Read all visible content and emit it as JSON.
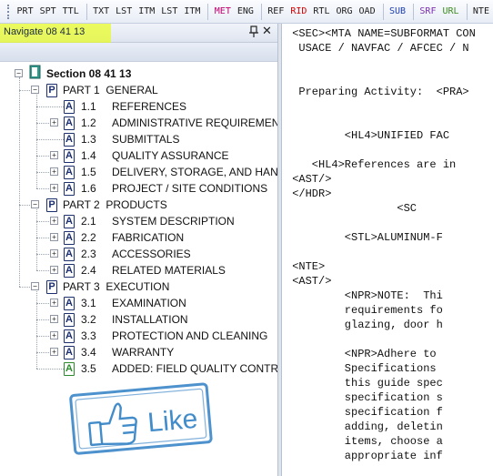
{
  "toolbar": {
    "groups": [
      [
        {
          "label": "PRT",
          "color": "#1d1d1d"
        },
        {
          "label": "SPT",
          "color": "#1d1d1d"
        },
        {
          "label": "TTL",
          "color": "#1d1d1d"
        }
      ],
      [
        {
          "label": "TXT",
          "color": "#1d1d1d"
        },
        {
          "label": "LST",
          "color": "#1d1d1d"
        },
        {
          "label": "ITM",
          "color": "#1d1d1d"
        },
        {
          "label": "LST",
          "color": "#1d1d1d"
        },
        {
          "label": "ITM",
          "color": "#1d1d1d"
        }
      ],
      [
        {
          "label": "MET",
          "color": "#c0006e"
        },
        {
          "label": "ENG",
          "color": "#1d1d1d"
        }
      ],
      [
        {
          "label": "REF",
          "color": "#1d1d1d"
        },
        {
          "label": "RID",
          "color": "#d40000"
        },
        {
          "label": "RTL",
          "color": "#1d1d1d"
        },
        {
          "label": "ORG",
          "color": "#1d1d1d"
        },
        {
          "label": "OAD",
          "color": "#1d1d1d"
        }
      ],
      [
        {
          "label": "SUB",
          "color": "#1d3fb0"
        }
      ],
      [
        {
          "label": "SRF",
          "color": "#7a2fb0"
        },
        {
          "label": "URL",
          "color": "#3c8c1e"
        }
      ],
      [
        {
          "label": "NTE",
          "color": "#1d1d1d"
        }
      ]
    ]
  },
  "nav": {
    "title": "Navigate 08 41 13",
    "highlight_color": "#e9ff00"
  },
  "tree": {
    "section": "Section 08 41 13",
    "parts": [
      {
        "label": "PART 1  GENERAL",
        "items": [
          {
            "num": "1.1",
            "title": "REFERENCES",
            "expandable": false
          },
          {
            "num": "1.2",
            "title": "ADMINISTRATIVE REQUIREMENTS",
            "expandable": true
          },
          {
            "num": "1.3",
            "title": "SUBMITTALS",
            "expandable": false
          },
          {
            "num": "1.4",
            "title": "QUALITY ASSURANCE",
            "expandable": true
          },
          {
            "num": "1.5",
            "title": "DELIVERY, STORAGE, AND HANDL",
            "expandable": true
          },
          {
            "num": "1.6",
            "title": "PROJECT / SITE CONDITIONS",
            "expandable": true
          }
        ]
      },
      {
        "label": "PART 2  PRODUCTS",
        "items": [
          {
            "num": "2.1",
            "title": "SYSTEM DESCRIPTION",
            "expandable": true
          },
          {
            "num": "2.2",
            "title": "FABRICATION",
            "expandable": true
          },
          {
            "num": "2.3",
            "title": "ACCESSORIES",
            "expandable": true
          },
          {
            "num": "2.4",
            "title": "RELATED MATERIALS",
            "expandable": true
          }
        ]
      },
      {
        "label": "PART 3  EXECUTION",
        "items": [
          {
            "num": "3.1",
            "title": "EXAMINATION",
            "expandable": true
          },
          {
            "num": "3.2",
            "title": "INSTALLATION",
            "expandable": true
          },
          {
            "num": "3.3",
            "title": "PROTECTION AND CLEANING",
            "expandable": true
          },
          {
            "num": "3.4",
            "title": "WARRANTY",
            "expandable": true
          },
          {
            "num": "3.5",
            "title": "ADDED: FIELD QUALITY CONTROL",
            "expandable": false,
            "added": true
          }
        ]
      }
    ]
  },
  "editor": {
    "lines": [
      {
        "text": "<SEC><MTA NAME=SUBFORMAT CON",
        "indent": 1,
        "row": 0
      },
      {
        "text": "USACE / NAVFAC / AFCEC / N",
        "indent": 2,
        "row": 1
      },
      {
        "text": "Preparing Activity:  <PRA>",
        "indent": 2,
        "row": 4
      },
      {
        "text": "<HL4>UNIFIED FAC",
        "indent": 9,
        "row": 7
      },
      {
        "text": "<HL4>References are in",
        "indent": 4,
        "row": 9
      },
      {
        "text": "<AST/>",
        "indent": 1,
        "row": 10
      },
      {
        "text": "</HDR>",
        "indent": 1,
        "row": 11
      },
      {
        "text": "<SC",
        "indent": 17,
        "row": 12
      },
      {
        "text": "<STL>ALUMINUM-F",
        "indent": 9,
        "row": 14
      },
      {
        "text": "<NTE>",
        "indent": 1,
        "row": 16
      },
      {
        "text": "<AST/>",
        "indent": 1,
        "row": 17
      },
      {
        "text": "<NPR>NOTE:  Thi",
        "indent": 9,
        "row": 18
      },
      {
        "text": "requirements fo",
        "indent": 9,
        "row": 19
      },
      {
        "text": "glazing, door h",
        "indent": 9,
        "row": 20
      },
      {
        "text": "<NPR>Adhere to",
        "indent": 9,
        "row": 22
      },
      {
        "text": "Specifications",
        "indent": 9,
        "row": 23
      },
      {
        "text": "this guide spec",
        "indent": 9,
        "row": 24
      },
      {
        "text": "specification s",
        "indent": 9,
        "row": 25
      },
      {
        "text": "specification f",
        "indent": 9,
        "row": 26
      },
      {
        "text": "adding, deletin",
        "indent": 9,
        "row": 27
      },
      {
        "text": "items, choose a",
        "indent": 9,
        "row": 28
      },
      {
        "text": "appropriate inf",
        "indent": 9,
        "row": 29
      }
    ]
  },
  "stamp": {
    "text": "Like",
    "color": "#2f7fc4"
  }
}
